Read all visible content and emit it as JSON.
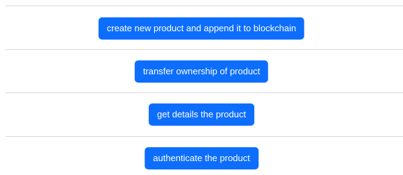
{
  "actions": {
    "create_label": "create new product and append it to blockchain",
    "transfer_label": "transfer ownership of product",
    "details_label": "get details the product",
    "authenticate_label": "authenticate the product"
  },
  "colors": {
    "button_bg": "#0d6efd",
    "divider": "#d9d9d9"
  }
}
